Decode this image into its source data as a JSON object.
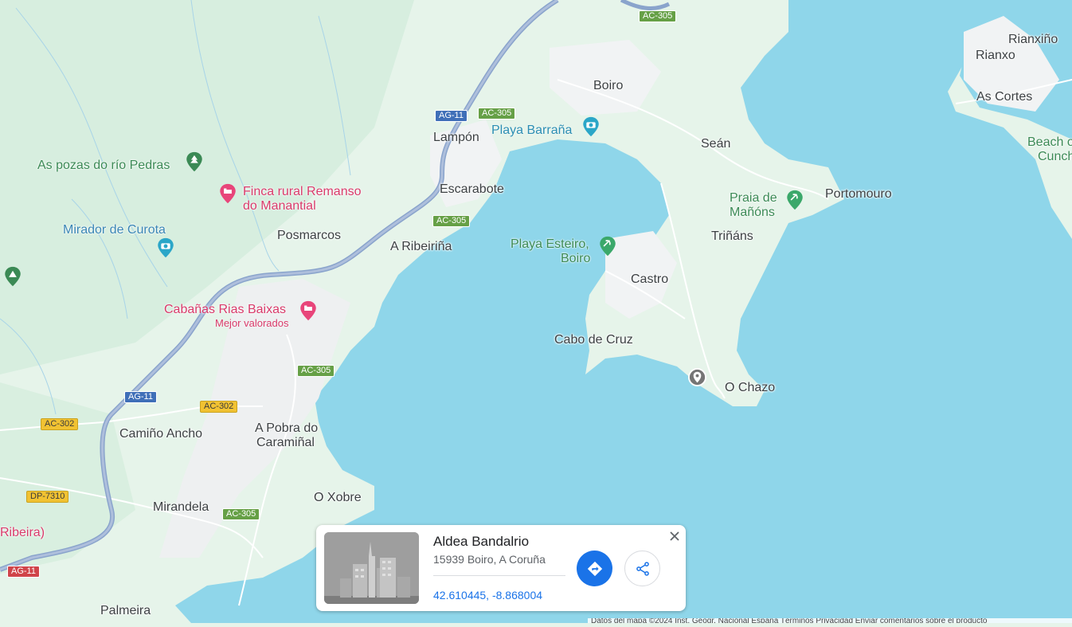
{
  "map": {
    "colors": {
      "water": "#8fd6ea",
      "land": "#e6f4ea",
      "urban": "#f1f3f4",
      "highway": "#8aa4cc"
    },
    "places": [
      {
        "name": "Boiro"
      },
      {
        "name": "Lampón"
      },
      {
        "name": "Escarabote"
      },
      {
        "name": "A Ribeiriña"
      },
      {
        "name": "Posmarcos"
      },
      {
        "name": "Seán"
      },
      {
        "name": "Portomouro"
      },
      {
        "name": "Triñáns"
      },
      {
        "name": "Castro"
      },
      {
        "name": "Cabo de Cruz"
      },
      {
        "name": "O Chazo"
      },
      {
        "name": "Camiño Ancho"
      },
      {
        "name": "A Pobra do"
      },
      {
        "name": "Caramiñal"
      },
      {
        "name": "O Xobre"
      },
      {
        "name": "Mirandela"
      },
      {
        "name": "Palmeira"
      },
      {
        "name": "Rianxiño"
      },
      {
        "name": "Rianxo"
      },
      {
        "name": "As Cortes"
      },
      {
        "name": "Ribeira)"
      }
    ],
    "pois": [
      {
        "name": "As pozas do río Pedras",
        "icon": "tree-icon"
      },
      {
        "name": "Finca rural Remanso",
        "name2": "do Manantial",
        "icon": "bed-icon"
      },
      {
        "name": "Mirador de Curota",
        "icon": "camera-icon"
      },
      {
        "name": "Cabañas Rias Baixas",
        "sub": "Mejor valorados",
        "icon": "bed-icon"
      },
      {
        "name": "Playa Barraña",
        "icon": "camera-icon"
      },
      {
        "name": "Playa Esteiro,",
        "name2": "Boiro",
        "icon": "beach-icon"
      },
      {
        "name": "Praia de",
        "name2": "Mañóns",
        "icon": "beach-icon"
      },
      {
        "name": "Beach o",
        "name2": "Cunch",
        "icon": "beach-icon"
      }
    ],
    "road_shields": [
      {
        "label": "AG-11",
        "kind": "blue"
      },
      {
        "label": "AG-11",
        "kind": "blue"
      },
      {
        "label": "AG-11",
        "kind": "red"
      },
      {
        "label": "AC-305",
        "kind": "green"
      },
      {
        "label": "AC-305",
        "kind": "green"
      },
      {
        "label": "AC-305",
        "kind": "green"
      },
      {
        "label": "AC-305",
        "kind": "green"
      },
      {
        "label": "AC-305",
        "kind": "green"
      },
      {
        "label": "AC-302",
        "kind": "yellow"
      },
      {
        "label": "AC-302",
        "kind": "yellow"
      },
      {
        "label": "DP-7310",
        "kind": "yellow"
      }
    ]
  },
  "card": {
    "title": "Aldea Bandalrio",
    "address": "15939 Boiro, A Coruña",
    "coordinates": "42.610445, -8.868004",
    "directions_icon": "directions-icon",
    "share_icon": "share-icon",
    "close_icon": "close-icon",
    "close_label": "×"
  },
  "attribution": "Datos del mapa ©2024 Inst. Geogr. Nacional  España  Términos  Privacidad  Enviar comentarios sobre el producto"
}
